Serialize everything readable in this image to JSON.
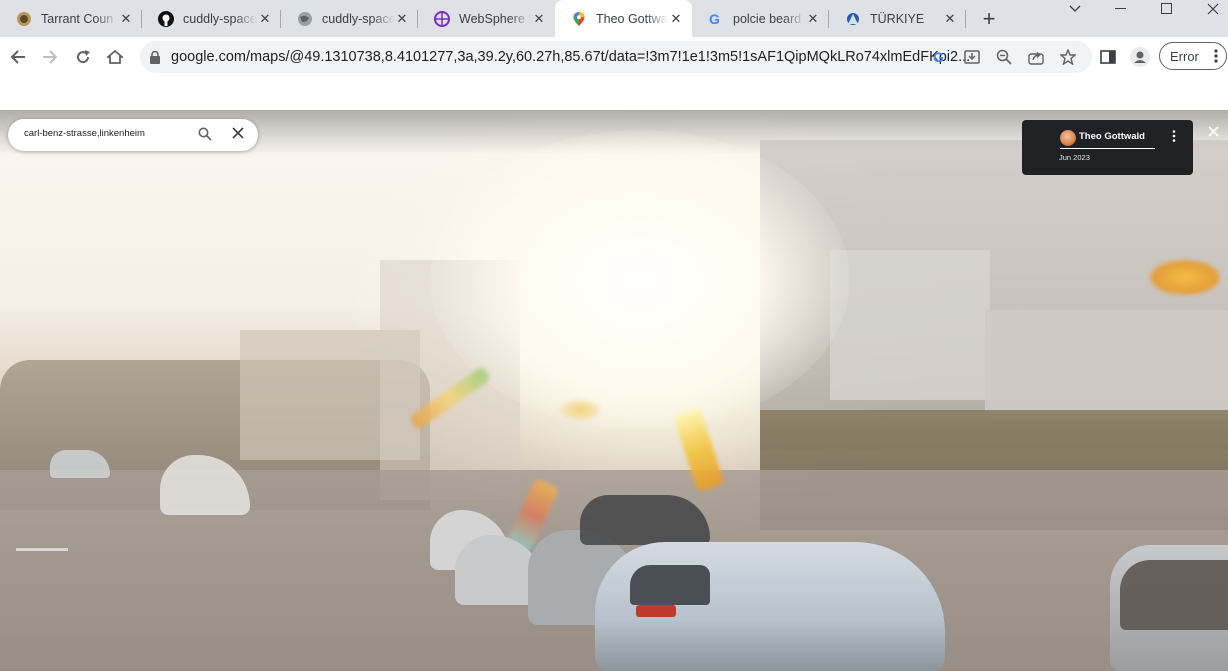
{
  "tabs": [
    {
      "title": "Tarrant Coun",
      "icon": "seal-icon"
    },
    {
      "title": "cuddly-space",
      "icon": "github-icon"
    },
    {
      "title": "cuddly-space",
      "icon": "globe-icon"
    },
    {
      "title": "WebSphere I",
      "icon": "websphere-icon"
    },
    {
      "title": "Theo Gottwa",
      "icon": "maps-pin-icon",
      "active": true
    },
    {
      "title": "polcie beard",
      "icon": "google-icon"
    },
    {
      "title": "TÜRKIYE",
      "icon": "interpol-icon"
    }
  ],
  "toolbar": {
    "url": "google.com/maps/@49.1310738,8.4101277,3a,39.2y,60.27h,85.67t/data=!3m7!1e1!3m5!1sAF1QipMQkLRo74xlmEdFKpi2...",
    "error_label": "Error"
  },
  "street_view": {
    "search_query": "carl-benz-strasse,linkenheim",
    "contributor_name": "Theo Gottwald",
    "capture_date": "Jun 2023"
  },
  "colors": {
    "tab_strip": "#dee1e6",
    "accent_blue": "#1a73e8",
    "card_bg": "#202124"
  }
}
